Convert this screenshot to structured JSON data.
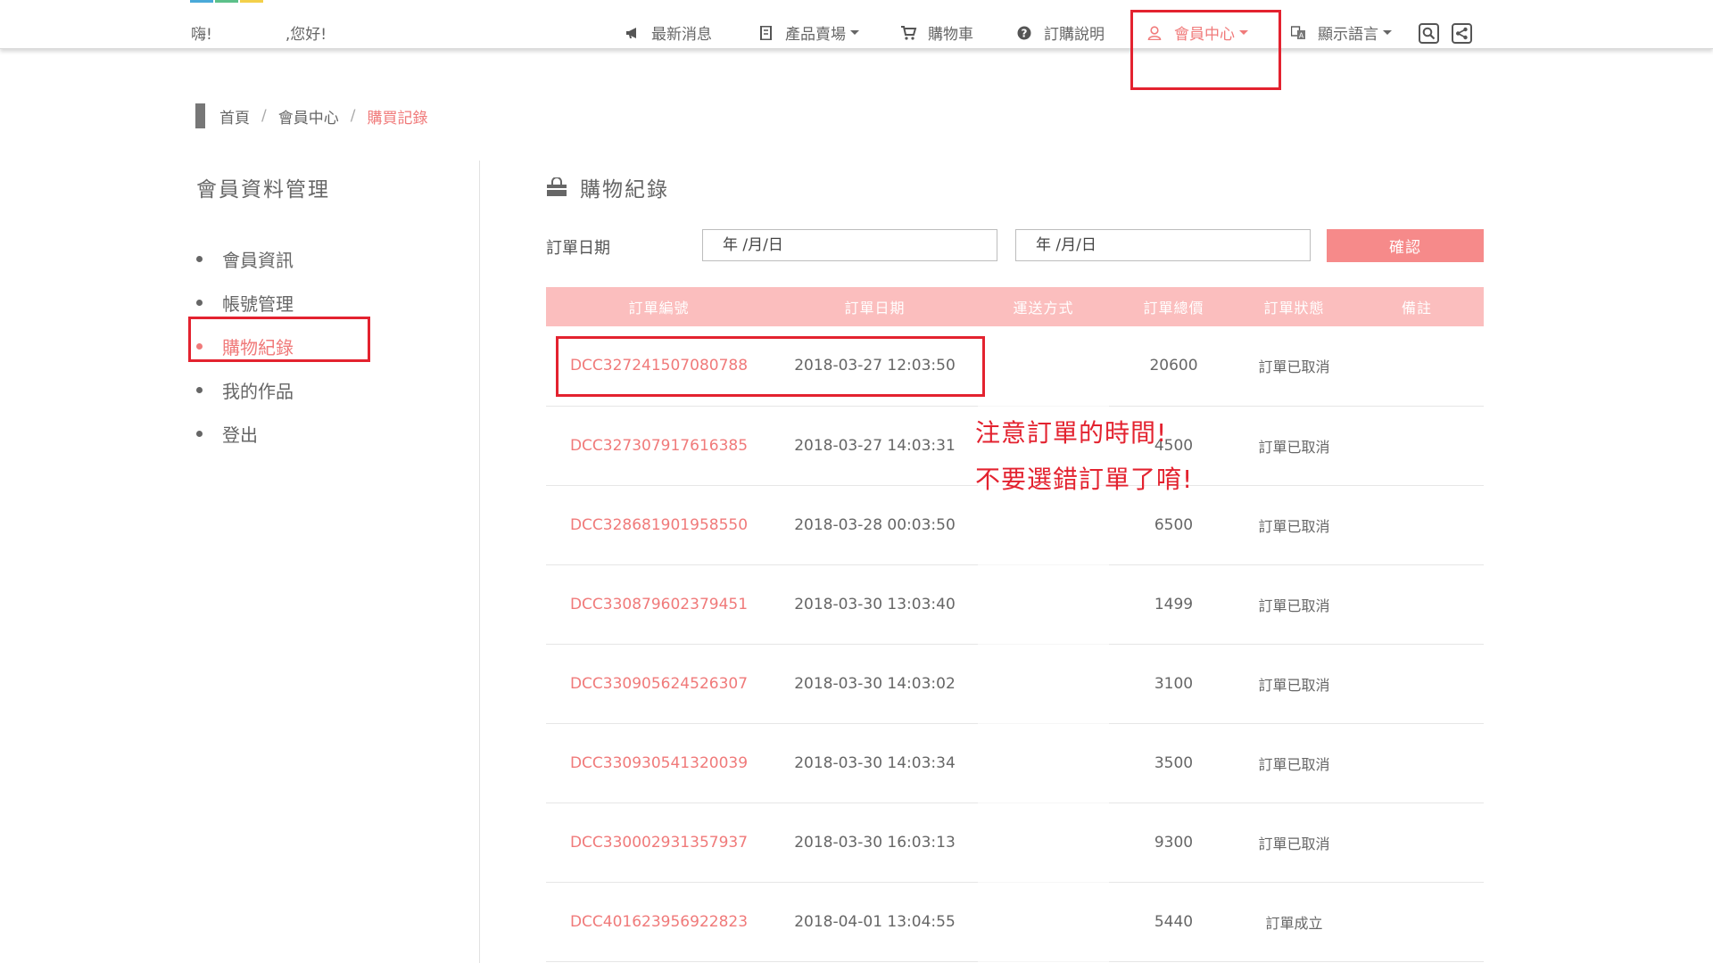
{
  "header": {
    "greeting_prefix": "嗨!",
    "greeting_suffix": ",您好!",
    "logo_colors": [
      "#4aa9d9",
      "#5cc08a",
      "#f3d04a"
    ],
    "nav": [
      {
        "label": "最新消息",
        "icon": "megaphone-icon",
        "dropdown": false
      },
      {
        "label": "產品賣場",
        "icon": "catalog-icon",
        "dropdown": true
      },
      {
        "label": "購物車",
        "icon": "cart-icon",
        "dropdown": false
      },
      {
        "label": "訂購說明",
        "icon": "question-icon",
        "dropdown": false
      },
      {
        "label": "會員中心",
        "icon": "user-icon",
        "dropdown": true,
        "active": true
      },
      {
        "label": "顯示語言",
        "icon": "language-icon",
        "dropdown": true
      }
    ],
    "tools": [
      "search-icon",
      "share-icon"
    ]
  },
  "breadcrumb": {
    "home": "首頁",
    "member": "會員中心",
    "current": "購買記錄"
  },
  "sidebar": {
    "title": "會員資料管理",
    "items": [
      {
        "label": "會員資訊"
      },
      {
        "label": "帳號管理"
      },
      {
        "label": "購物紀錄",
        "active": true
      },
      {
        "label": "我的作品"
      },
      {
        "label": "登出"
      }
    ]
  },
  "main": {
    "title": "購物紀錄",
    "filter": {
      "label": "訂單日期",
      "start_placeholder": "年 /月/日",
      "end_placeholder": "年 /月/日",
      "confirm": "確認"
    },
    "table": {
      "headers": [
        "訂單編號",
        "訂單日期",
        "運送方式",
        "訂單總價",
        "訂單狀態",
        "備註"
      ],
      "rows": [
        {
          "id": "DCC327241507080788",
          "date": "2018-03-27 12:03:50",
          "shipping": "",
          "total": "20600",
          "status": "訂單已取消",
          "note": ""
        },
        {
          "id": "DCC327307917616385",
          "date": "2018-03-27 14:03:31",
          "shipping": "",
          "total": "4500",
          "status": "訂單已取消",
          "note": ""
        },
        {
          "id": "DCC328681901958550",
          "date": "2018-03-28 00:03:50",
          "shipping": "",
          "total": "6500",
          "status": "訂單已取消",
          "note": ""
        },
        {
          "id": "DCC330879602379451",
          "date": "2018-03-30 13:03:40",
          "shipping": "",
          "total": "1499",
          "status": "訂單已取消",
          "note": ""
        },
        {
          "id": "DCC330905624526307",
          "date": "2018-03-30 14:03:02",
          "shipping": "",
          "total": "3100",
          "status": "訂單已取消",
          "note": ""
        },
        {
          "id": "DCC330930541320039",
          "date": "2018-03-30 14:03:34",
          "shipping": "",
          "total": "3500",
          "status": "訂單已取消",
          "note": ""
        },
        {
          "id": "DCC330002931357937",
          "date": "2018-03-30 16:03:13",
          "shipping": "",
          "total": "9300",
          "status": "訂單已取消",
          "note": ""
        },
        {
          "id": "DCC401623956922823",
          "date": "2018-04-01 13:04:55",
          "shipping": "",
          "total": "5440",
          "status": "訂單成立",
          "note": ""
        }
      ]
    }
  },
  "annotation": {
    "line1": "注意訂單的時間!",
    "line2": "不要選錯訂單了唷!",
    "color": "#e3222f"
  },
  "theme": {
    "accent": "#f07a7a",
    "table_header_bg": "#fbbebe",
    "button_bg": "#f68a8a"
  }
}
